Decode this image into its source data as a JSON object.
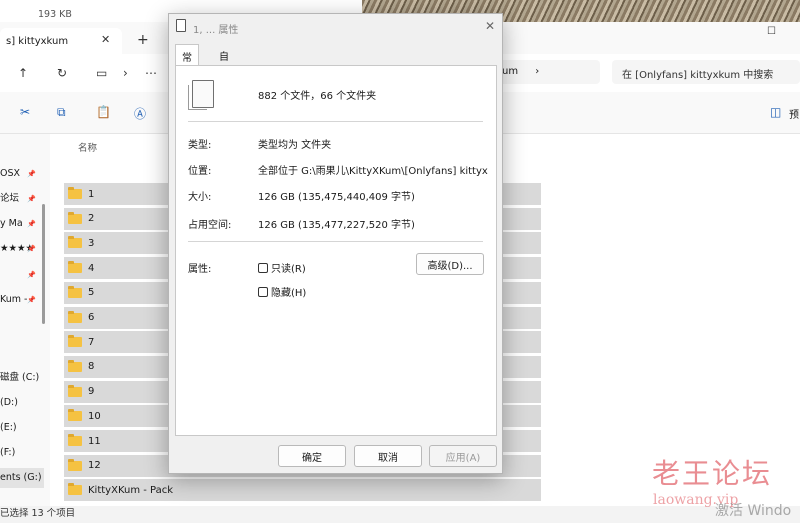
{
  "background": {
    "size_text": "193 KB"
  },
  "explorer": {
    "tab_title": "s] kittyxkum",
    "tab_close": "✕",
    "tab_add": "+",
    "window_max": "☐",
    "address_visible": "um",
    "address_chevron": "›",
    "search_placeholder": "在 [Onlyfans] kittyxkum 中搜索",
    "toolbar": {
      "preview_label": "预"
    },
    "sidebar": [
      {
        "label": "OSX",
        "pinned": true
      },
      {
        "label": "论坛",
        "pinned": true
      },
      {
        "label": "y Ma",
        "pinned": true
      },
      {
        "label": "★★★★",
        "pinned": true
      },
      {
        "label": "",
        "pinned": true
      },
      {
        "label": "Kum -",
        "pinned": true
      },
      {
        "label": "磁盘 (C:)",
        "pinned": false
      },
      {
        "label": "(D:)",
        "pinned": false
      },
      {
        "label": "(E:)",
        "pinned": false
      },
      {
        "label": "(F:)",
        "pinned": false
      },
      {
        "label": "ents (G:)",
        "pinned": false
      },
      {
        "label": "ents (G:)",
        "pinned": false
      }
    ],
    "column_header": "名称",
    "folders": [
      "1",
      "2",
      "3",
      "4",
      "5",
      "6",
      "7",
      "8",
      "9",
      "10",
      "11",
      "12",
      "KittyXKum - Pack"
    ],
    "status_text": "已选择 13 个项目"
  },
  "watermark": {
    "main": "老王论坛",
    "sub": "laowang.vip",
    "activate": "激活 Windo"
  },
  "dialog": {
    "title": "1, ... 属性",
    "close": "✕",
    "tabs": [
      "常规",
      "自定义"
    ],
    "summary": "882 个文件，66 个文件夹",
    "rows": [
      {
        "label": "类型:",
        "value": "类型均为 文件夹"
      },
      {
        "label": "位置:",
        "value": "全部位于 G:\\雨果儿\\KittyXKum\\[Onlyfans] kittyxkum"
      },
      {
        "label": "大小:",
        "value": "126 GB (135,475,440,409 字节)"
      },
      {
        "label": "占用空间:",
        "value": "126 GB (135,477,227,520 字节)"
      }
    ],
    "attributes_label": "属性:",
    "readonly_label": "只读(R)",
    "hidden_label": "隐藏(H)",
    "advanced_button": "高级(D)...",
    "ok_button": "确定",
    "cancel_button": "取消",
    "apply_button": "应用(A)"
  }
}
